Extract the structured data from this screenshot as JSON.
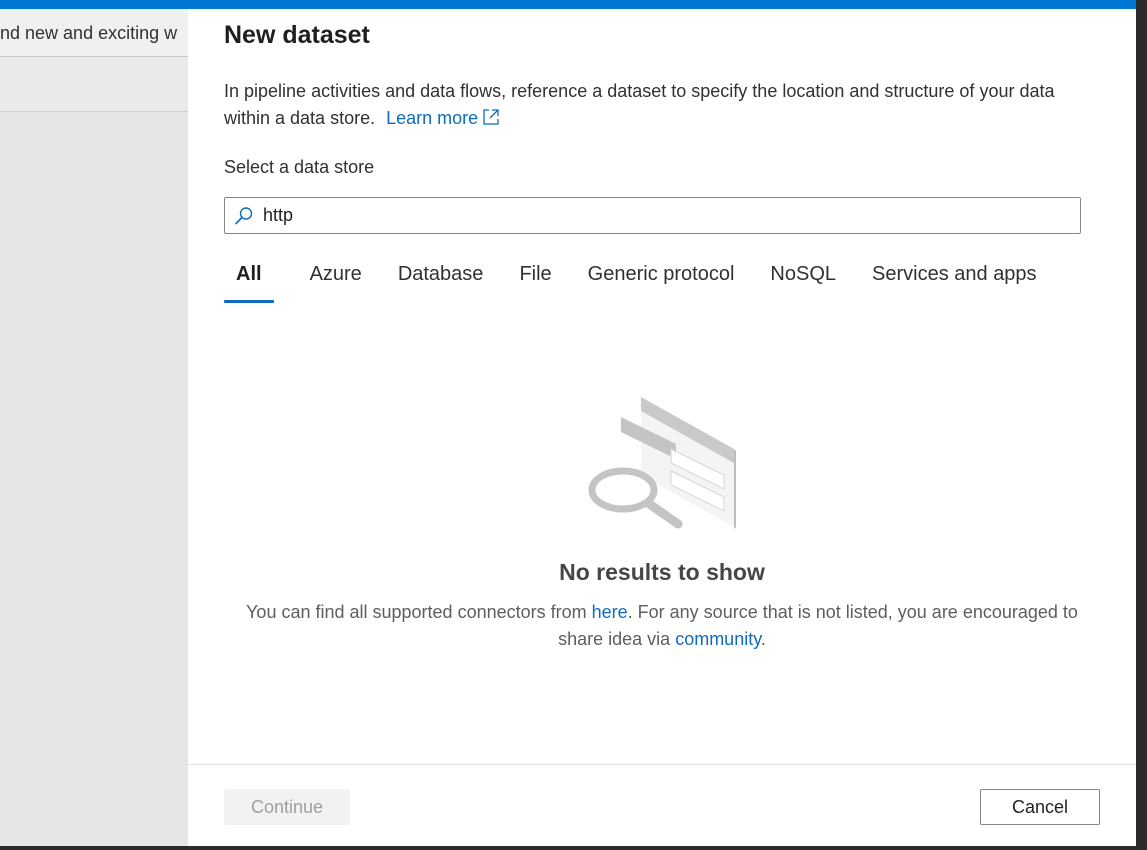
{
  "background": {
    "banner_text": "nd new and exciting w"
  },
  "panel": {
    "title": "New dataset",
    "description": "In pipeline activities and data flows, reference a dataset to specify the location and structure of your data within a data store.",
    "learn_more": "Learn more",
    "select_label": "Select a data store",
    "search": {
      "value": "http",
      "icon": "search-icon"
    },
    "tabs": [
      {
        "label": "All",
        "active": true
      },
      {
        "label": "Azure",
        "active": false
      },
      {
        "label": "Database",
        "active": false
      },
      {
        "label": "File",
        "active": false
      },
      {
        "label": "Generic protocol",
        "active": false
      },
      {
        "label": "NoSQL",
        "active": false
      },
      {
        "label": "Services and apps",
        "active": false
      }
    ],
    "empty_state": {
      "title": "No results to show",
      "text_before_here": "You can find all supported connectors from ",
      "here_link": "here",
      "text_after_here": ". For any source that is not listed, you are encouraged to share idea via ",
      "community_link": "community",
      "text_end": "."
    },
    "footer": {
      "continue_label": "Continue",
      "continue_disabled": true,
      "cancel_label": "Cancel"
    }
  },
  "colors": {
    "accent": "#0078d4",
    "link": "#0f6cbd"
  }
}
